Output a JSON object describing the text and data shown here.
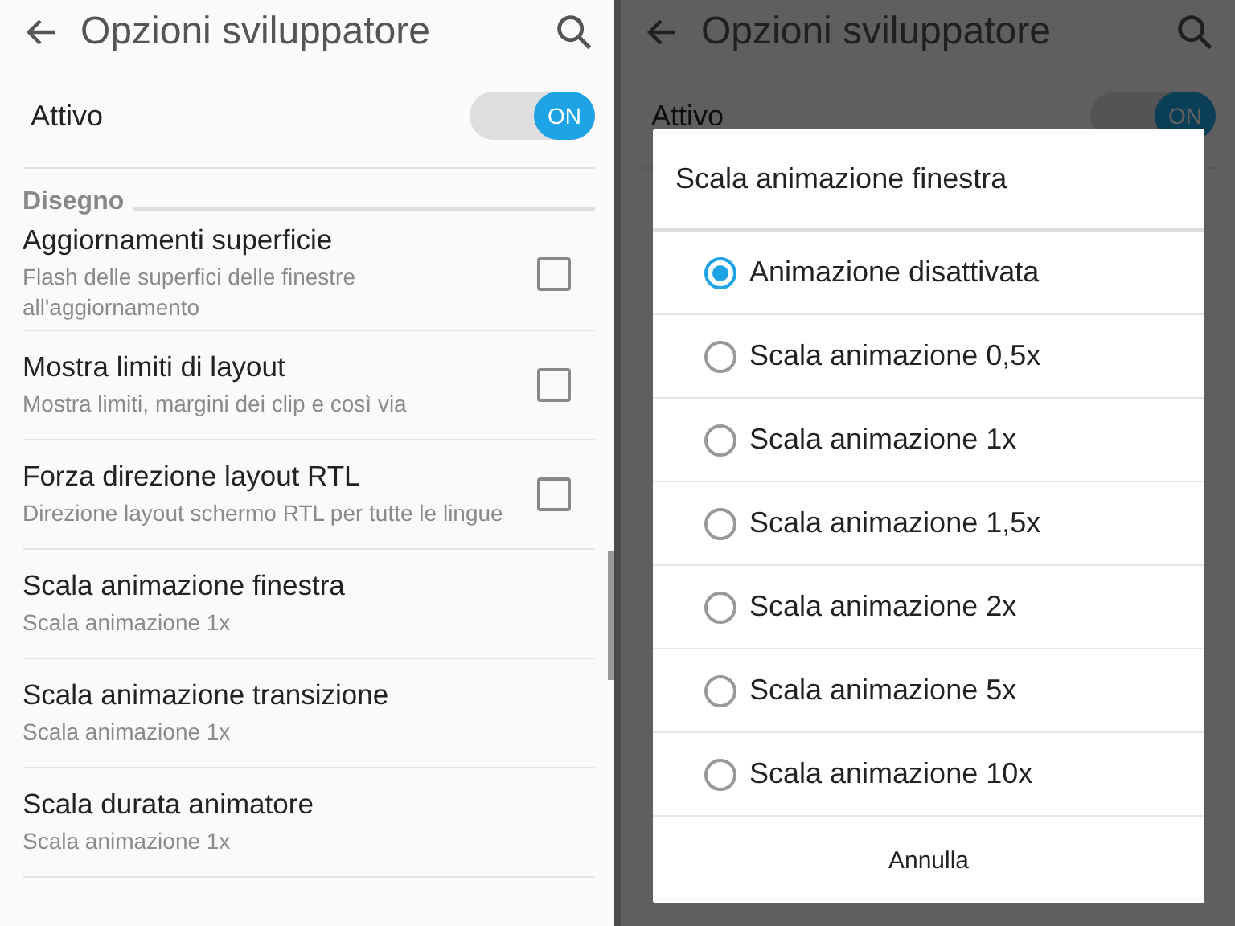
{
  "left_screen": {
    "app_bar": {
      "title": "Opzioni sviluppatore"
    },
    "master_switch": {
      "label": "Attivo",
      "on": true,
      "state_label": "ON"
    },
    "section_header": "Disegno",
    "settings": [
      {
        "kind": "checkbox",
        "title": "Aggiornamenti superficie",
        "summary": "Flash delle superfici delle finestre all'aggiornamento",
        "checked": false
      },
      {
        "kind": "checkbox",
        "title": "Mostra limiti di layout",
        "summary": "Mostra limiti, margini dei clip e così via",
        "checked": false
      },
      {
        "kind": "checkbox",
        "title": "Forza direzione layout RTL",
        "summary": "Direzione layout schermo RTL per tutte le lingue",
        "checked": false
      },
      {
        "kind": "value",
        "title": "Scala animazione finestra",
        "summary": "Scala animazione 1x"
      },
      {
        "kind": "value",
        "title": "Scala animazione transizione",
        "summary": "Scala animazione 1x"
      },
      {
        "kind": "value",
        "title": "Scala durata animatore",
        "summary": "Scala animazione 1x"
      }
    ]
  },
  "right_screen": {
    "app_bar": {
      "title": "Opzioni sviluppatore"
    },
    "master_switch": {
      "label": "Attivo",
      "on": true,
      "state_label": "ON"
    },
    "dialog": {
      "title": "Scala animazione finestra",
      "options": [
        {
          "label": "Animazione disattivata",
          "selected": true
        },
        {
          "label": "Scala animazione 0,5x",
          "selected": false
        },
        {
          "label": "Scala animazione 1x",
          "selected": false
        },
        {
          "label": "Scala animazione 1,5x",
          "selected": false
        },
        {
          "label": "Scala animazione 2x",
          "selected": false
        },
        {
          "label": "Scala animazione 5x",
          "selected": false
        },
        {
          "label": "Scala animazione 10x",
          "selected": false
        }
      ],
      "cancel": "Annulla"
    }
  }
}
